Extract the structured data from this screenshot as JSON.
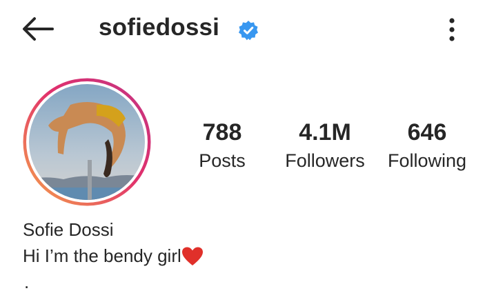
{
  "header": {
    "back_icon": "arrow-left-icon",
    "username": "sofiedossi",
    "verified_icon": "verified-badge-icon",
    "more_icon": "more-vertical-icon"
  },
  "profile": {
    "avatar_icon": "profile-photo",
    "stats": [
      {
        "value": "788",
        "label": "Posts"
      },
      {
        "value": "4.1M",
        "label": "Followers"
      },
      {
        "value": "646",
        "label": "Following"
      }
    ],
    "full_name": "Sofie Dossi",
    "bio_text": "Hi I’m the bendy girl",
    "bio_emoji": "heart-icon",
    "bio_extra": "."
  },
  "colors": {
    "verified": "#3897f0",
    "heart": "#e0302a",
    "ring_start": "#c13584",
    "ring_end": "#f5a64a"
  }
}
